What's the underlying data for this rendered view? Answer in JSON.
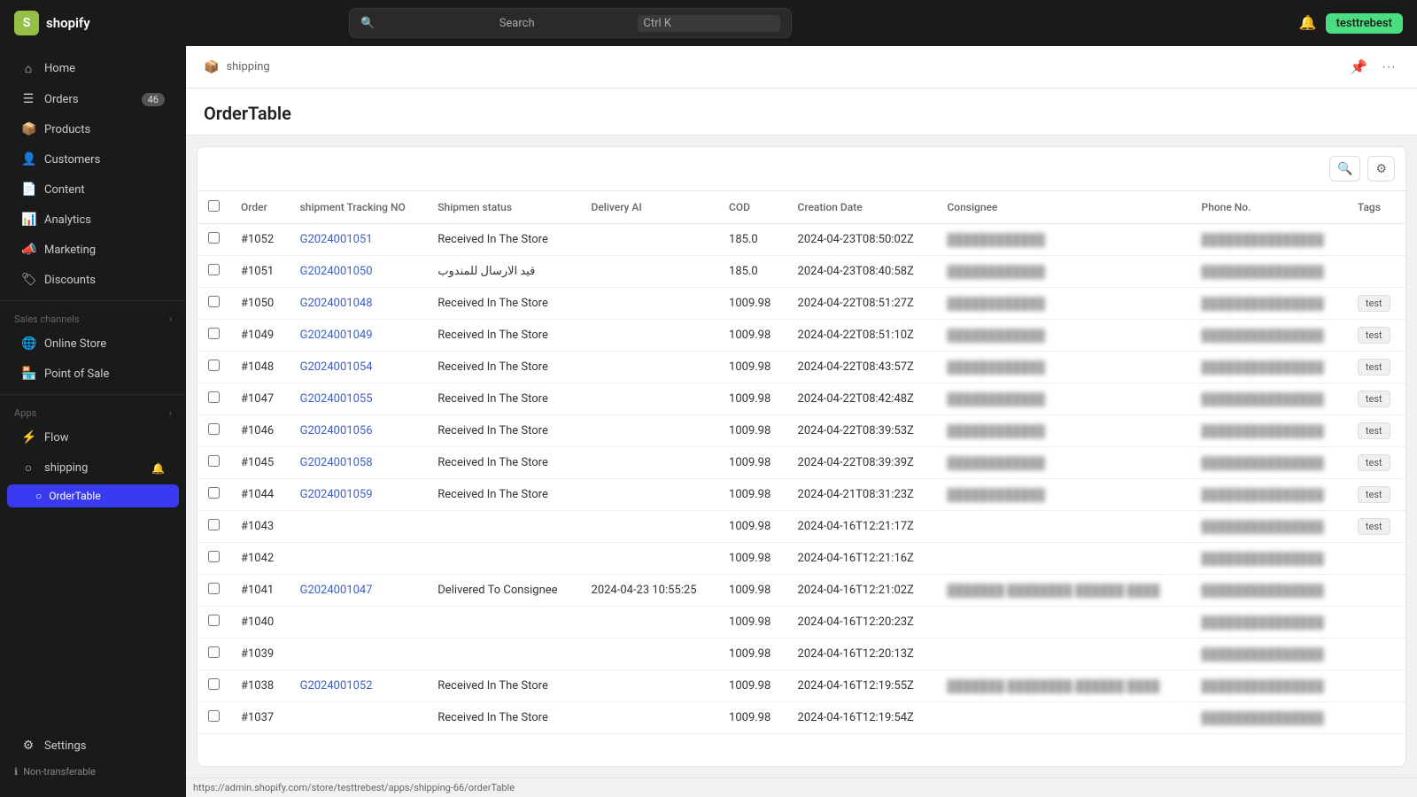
{
  "topbar": {
    "logo_text": "shopify",
    "search_placeholder": "Search",
    "search_shortcut": "Ctrl K",
    "user_name": "testtrebest",
    "notification_icon": "🔔"
  },
  "sidebar": {
    "items": [
      {
        "id": "home",
        "label": "Home",
        "icon": "⌂",
        "badge": null
      },
      {
        "id": "orders",
        "label": "Orders",
        "icon": "☰",
        "badge": "46"
      },
      {
        "id": "products",
        "label": "Products",
        "icon": "📦",
        "badge": null
      },
      {
        "id": "customers",
        "label": "Customers",
        "icon": "👤",
        "badge": null
      },
      {
        "id": "content",
        "label": "Content",
        "icon": "📄",
        "badge": null
      },
      {
        "id": "analytics",
        "label": "Analytics",
        "icon": "📊",
        "badge": null
      },
      {
        "id": "marketing",
        "label": "Marketing",
        "icon": "📣",
        "badge": null
      },
      {
        "id": "discounts",
        "label": "Discounts",
        "icon": "🏷",
        "badge": null
      }
    ],
    "sales_channels_label": "Sales channels",
    "sales_channels": [
      {
        "id": "online-store",
        "label": "Online Store",
        "icon": "🌐"
      },
      {
        "id": "point-of-sale",
        "label": "Point of Sale",
        "icon": "🏪"
      }
    ],
    "apps_label": "Apps",
    "apps": [
      {
        "id": "flow",
        "label": "Flow",
        "icon": "⚡"
      }
    ],
    "app_shipping": "shipping",
    "app_order_table": "OrderTable",
    "settings_label": "Settings",
    "non_transferable": "Non-transferable"
  },
  "header": {
    "breadcrumb_icon": "📦",
    "breadcrumb_text": "shipping",
    "pin_icon": "📌",
    "more_icon": "···"
  },
  "page": {
    "title": "OrderTable"
  },
  "table": {
    "columns": [
      "",
      "Order",
      "shipment Tracking NO",
      "Shipmen status",
      "Delivery AI",
      "COD",
      "Creation Date",
      "Consignee",
      "Phone No.",
      "Tags"
    ],
    "rows": [
      {
        "order": "#1052",
        "tracking": "G2024001051",
        "status": "Received In The Store",
        "delivery_ai": "",
        "cod": "185.0",
        "date": "2024-04-23T08:50:02Z",
        "consignee": "████████████",
        "phone": "███████████████",
        "tags": ""
      },
      {
        "order": "#1051",
        "tracking": "G2024001050",
        "status": "قيد الارسال للمندوب",
        "delivery_ai": "",
        "cod": "185.0",
        "date": "2024-04-23T08:40:58Z",
        "consignee": "████████████",
        "phone": "███████████████",
        "tags": ""
      },
      {
        "order": "#1050",
        "tracking": "G2024001048",
        "status": "Received In The Store",
        "delivery_ai": "",
        "cod": "1009.98",
        "date": "2024-04-22T08:51:27Z",
        "consignee": "████████████",
        "phone": "███████████████",
        "tags": "test"
      },
      {
        "order": "#1049",
        "tracking": "G2024001049",
        "status": "Received In The Store",
        "delivery_ai": "",
        "cod": "1009.98",
        "date": "2024-04-22T08:51:10Z",
        "consignee": "████████████",
        "phone": "███████████████",
        "tags": "test"
      },
      {
        "order": "#1048",
        "tracking": "G2024001054",
        "status": "Received In The Store",
        "delivery_ai": "",
        "cod": "1009.98",
        "date": "2024-04-22T08:43:57Z",
        "consignee": "████████████",
        "phone": "███████████████",
        "tags": "test"
      },
      {
        "order": "#1047",
        "tracking": "G2024001055",
        "status": "Received In The Store",
        "delivery_ai": "",
        "cod": "1009.98",
        "date": "2024-04-22T08:42:48Z",
        "consignee": "████████████",
        "phone": "███████████████",
        "tags": "test"
      },
      {
        "order": "#1046",
        "tracking": "G2024001056",
        "status": "Received In The Store",
        "delivery_ai": "",
        "cod": "1009.98",
        "date": "2024-04-22T08:39:53Z",
        "consignee": "████████████",
        "phone": "███████████████",
        "tags": "test"
      },
      {
        "order": "#1045",
        "tracking": "G2024001058",
        "status": "Received In The Store",
        "delivery_ai": "",
        "cod": "1009.98",
        "date": "2024-04-22T08:39:39Z",
        "consignee": "████████████",
        "phone": "███████████████",
        "tags": "test"
      },
      {
        "order": "#1044",
        "tracking": "G2024001059",
        "status": "Received In The Store",
        "delivery_ai": "",
        "cod": "1009.98",
        "date": "2024-04-21T08:31:23Z",
        "consignee": "████████████",
        "phone": "███████████████",
        "tags": "test"
      },
      {
        "order": "#1043",
        "tracking": "",
        "status": "",
        "delivery_ai": "",
        "cod": "1009.98",
        "date": "2024-04-16T12:21:17Z",
        "consignee": "",
        "phone": "███████████████",
        "tags": "test"
      },
      {
        "order": "#1042",
        "tracking": "",
        "status": "",
        "delivery_ai": "",
        "cod": "1009.98",
        "date": "2024-04-16T12:21:16Z",
        "consignee": "",
        "phone": "███████████████",
        "tags": ""
      },
      {
        "order": "#1041",
        "tracking": "G2024001047",
        "status": "Delivered To Consignee",
        "delivery_ai": "2024-04-23 10:55:25",
        "cod": "1009.98",
        "date": "2024-04-16T12:21:02Z",
        "consignee": "███████ ████████ ██████ ████",
        "phone": "███████████████",
        "tags": ""
      },
      {
        "order": "#1040",
        "tracking": "",
        "status": "",
        "delivery_ai": "",
        "cod": "1009.98",
        "date": "2024-04-16T12:20:23Z",
        "consignee": "",
        "phone": "███████████████",
        "tags": ""
      },
      {
        "order": "#1039",
        "tracking": "",
        "status": "",
        "delivery_ai": "",
        "cod": "1009.98",
        "date": "2024-04-16T12:20:13Z",
        "consignee": "",
        "phone": "███████████████",
        "tags": ""
      },
      {
        "order": "#1038",
        "tracking": "G2024001052",
        "status": "Received In The Store",
        "delivery_ai": "",
        "cod": "1009.98",
        "date": "2024-04-16T12:19:55Z",
        "consignee": "███████ ████████ ██████ ████",
        "phone": "███████████████",
        "tags": ""
      },
      {
        "order": "#1037",
        "tracking": "",
        "status": "Received In The Store",
        "delivery_ai": "",
        "cod": "1009.98",
        "date": "2024-04-16T12:19:54Z",
        "consignee": "",
        "phone": "███████████████",
        "tags": ""
      }
    ]
  },
  "status_bar": {
    "url": "https://admin.shopify.com/store/testtrebest/apps/shipping-66/orderTable"
  }
}
